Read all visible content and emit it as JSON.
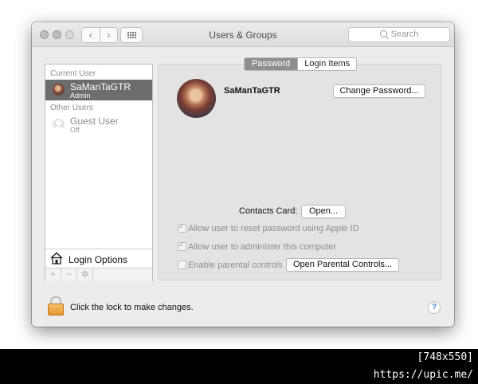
{
  "window": {
    "title": "Users & Groups"
  },
  "toolbar": {
    "back_icon": "chevron-left-icon",
    "forward_icon": "chevron-right-icon",
    "back_glyph": "‹",
    "forward_glyph": "›",
    "grid_icon": "grid-icon"
  },
  "search": {
    "placeholder": "Search"
  },
  "sidebar": {
    "current_user_header": "Current User",
    "current_user": {
      "name": "SaManTaGTR",
      "role": "Admin"
    },
    "other_users_header": "Other Users",
    "other_users": [
      {
        "name": "Guest User",
        "role": "Off"
      }
    ],
    "login_options_label": "Login Options",
    "add_glyph": "+",
    "remove_glyph": "−",
    "action_glyph": "✲"
  },
  "tabs": {
    "password": "Password",
    "login_items": "Login Items",
    "active": "Password"
  },
  "account": {
    "name": "SaManTaGTR",
    "change_password_label": "Change Password...",
    "contacts_card_label": "Contacts Card:",
    "open_label": "Open...",
    "options": [
      {
        "label": "Allow user to reset password using Apple ID",
        "checked": true
      },
      {
        "label": "Allow user to administer this computer",
        "checked": true
      },
      {
        "label": "Enable parental controls",
        "checked": false
      }
    ],
    "open_parental_label": "Open Parental Controls..."
  },
  "footer": {
    "lock_message": "Click the lock to make changes.",
    "help_glyph": "?"
  },
  "watermark": "[748x550] https://upic.me/",
  "colors": {
    "selection": "#6d6d6d",
    "lock": "#e6962e",
    "help": "#3a7bd5"
  }
}
